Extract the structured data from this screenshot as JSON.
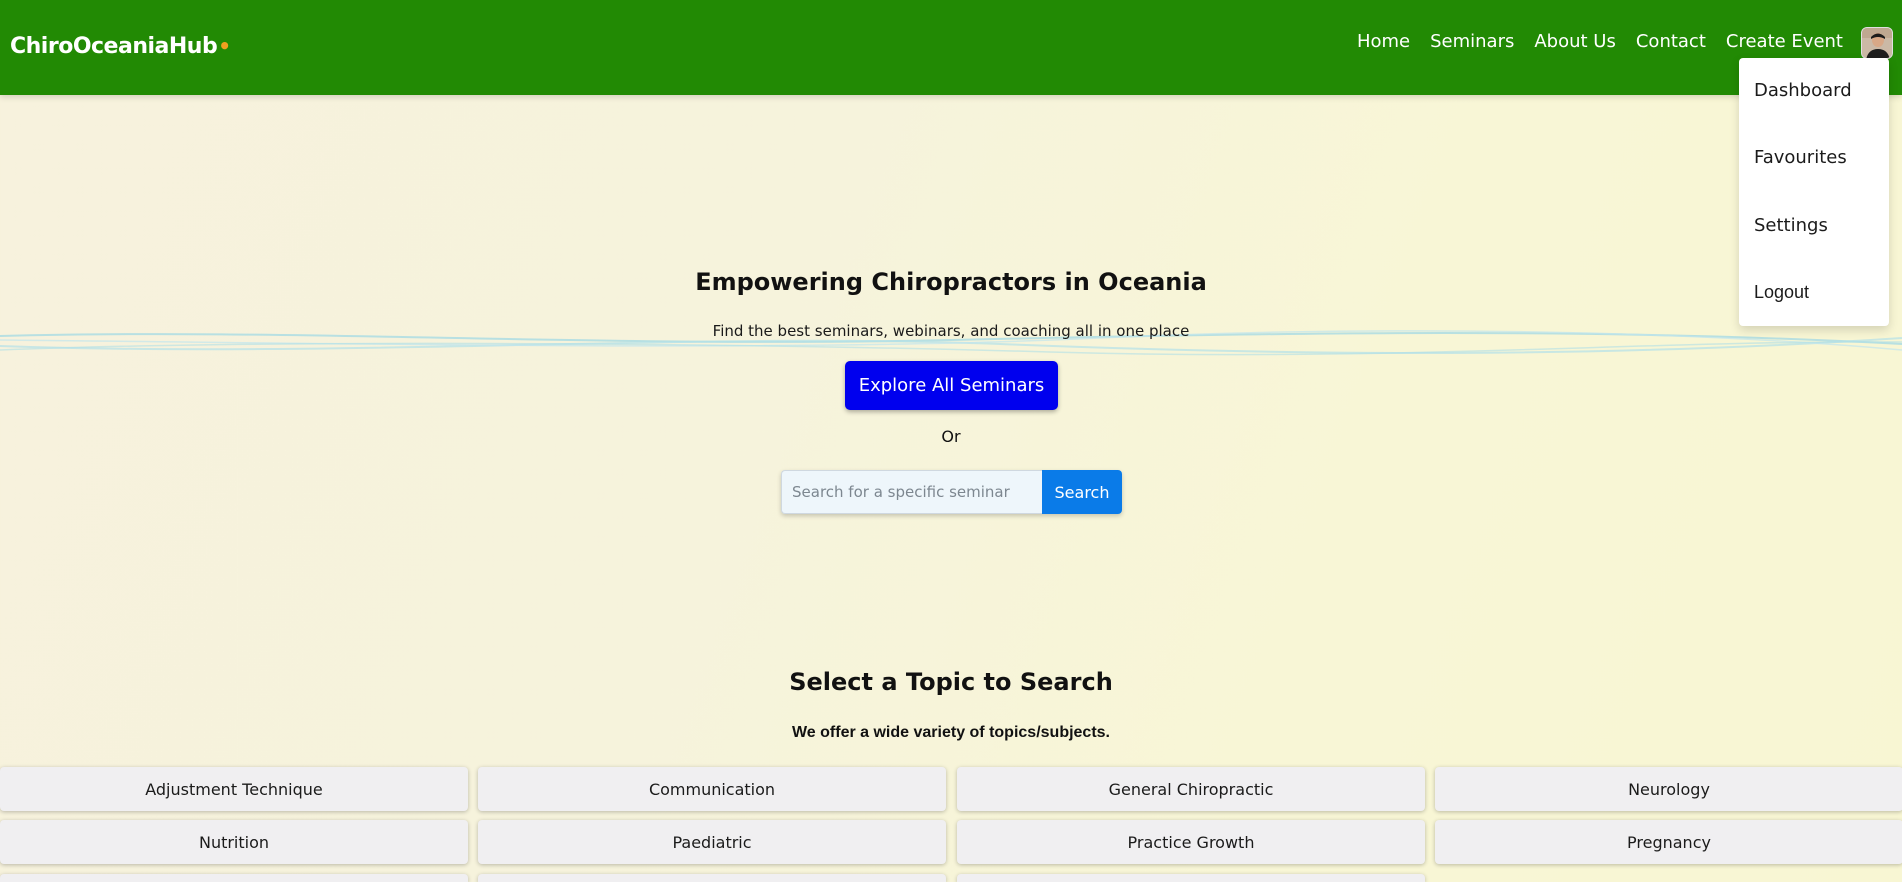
{
  "navbar": {
    "brand": "ChiroOceaniaHub",
    "brand_dot": "•",
    "links": [
      "Home",
      "Seminars",
      "About Us",
      "Contact",
      "Create Event"
    ]
  },
  "user_menu": {
    "items": [
      "Dashboard",
      "Favourites",
      "Settings",
      "Logout"
    ]
  },
  "hero": {
    "title": "Empowering Chiropractors in Oceania",
    "subtitle": "Find the best seminars, webinars, and coaching all in one place",
    "explore_label": "Explore All Seminars",
    "or_text": "Or",
    "search_placeholder": "Search for a specific seminar",
    "search_value": "",
    "search_label": "Search"
  },
  "topics": {
    "title": "Select a Topic to Search",
    "subtitle": "We offer a wide variety of topics/subjects.",
    "items": [
      "Adjustment Technique",
      "Communication",
      "General Chiropractic",
      "Neurology",
      "Nutrition",
      "Paediatric",
      "Practice Growth",
      "Pregnancy"
    ]
  },
  "colors": {
    "navbar": "#228a04",
    "explore_button": "#0000ee",
    "search_button": "#0a7be8",
    "brand_dot": "#f0a020"
  }
}
